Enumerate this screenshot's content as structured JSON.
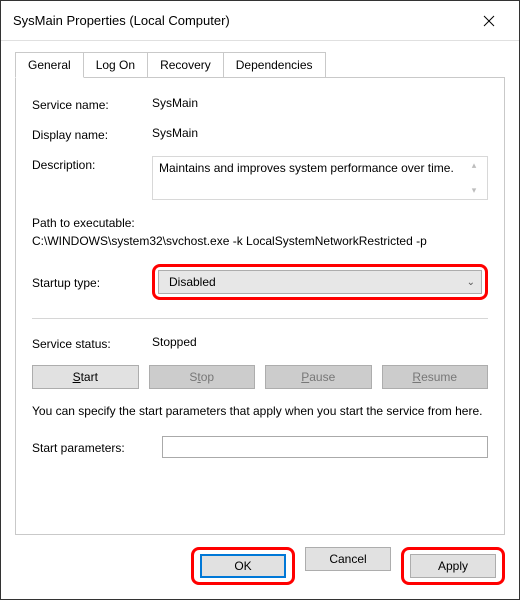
{
  "window": {
    "title": "SysMain Properties (Local Computer)"
  },
  "tabs": {
    "general": "General",
    "logon": "Log On",
    "recovery": "Recovery",
    "dependencies": "Dependencies"
  },
  "labels": {
    "service_name": "Service name:",
    "display_name": "Display name:",
    "description": "Description:",
    "path_title": "Path to executable:",
    "startup_type": "Startup type:",
    "service_status": "Service status:",
    "note": "You can specify the start parameters that apply when you start the service from here.",
    "start_parameters": "Start parameters:"
  },
  "values": {
    "service_name": "SysMain",
    "display_name": "SysMain",
    "description": "Maintains and improves system performance over time.",
    "path": "C:\\WINDOWS\\system32\\svchost.exe -k LocalSystemNetworkRestricted -p",
    "startup_type_selected": "Disabled",
    "service_status": "Stopped",
    "start_parameters": ""
  },
  "buttons": {
    "start": "Start",
    "stop": "Stop",
    "pause": "Pause",
    "resume": "Resume",
    "ok": "OK",
    "cancel": "Cancel",
    "apply": "Apply"
  },
  "highlights": {
    "color": "#ff0000"
  }
}
